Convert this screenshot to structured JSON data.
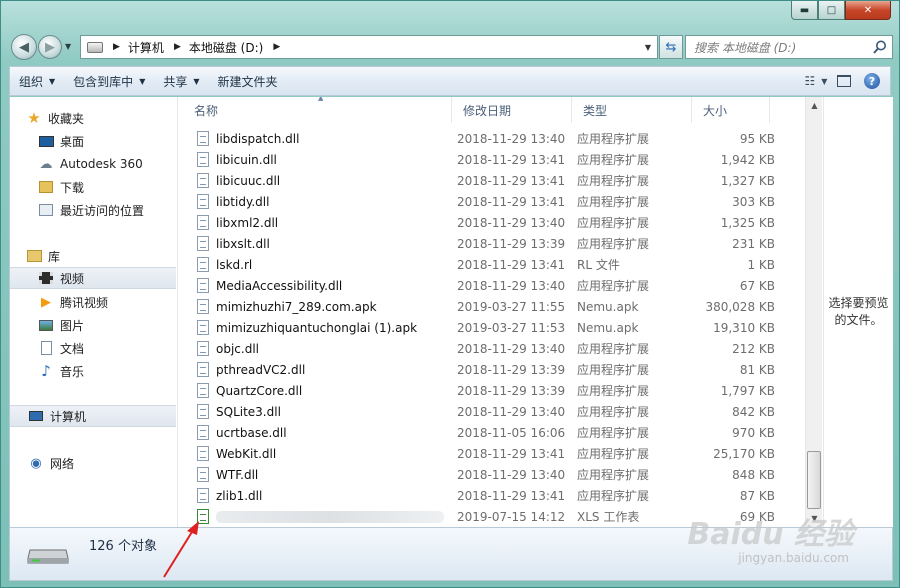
{
  "window": {
    "min_label": "▬",
    "max_label": "□",
    "close_label": "✕"
  },
  "address": {
    "segments": [
      "计算机",
      "本地磁盘 (D:)"
    ],
    "search_placeholder": "搜索 本地磁盘 (D:)"
  },
  "toolbar": {
    "organize": "组织",
    "include_in_library": "包含到库中",
    "share": "共享",
    "new_folder": "新建文件夹"
  },
  "sidebar": {
    "favorites": "收藏夹",
    "desktop": "桌面",
    "autodesk": "Autodesk 360",
    "downloads": "下载",
    "recent": "最近访问的位置",
    "libraries": "库",
    "videos": "视频",
    "tencent_video": "腾讯视频",
    "pictures": "图片",
    "documents": "文档",
    "music": "音乐",
    "computer": "计算机",
    "network": "网络"
  },
  "columns": {
    "name": "名称",
    "date": "修改日期",
    "type": "类型",
    "size": "大小"
  },
  "files": [
    {
      "name": "libdispatch.dll",
      "date": "2018-11-29 13:40",
      "type": "应用程序扩展",
      "size": "95 KB"
    },
    {
      "name": "libicuin.dll",
      "date": "2018-11-29 13:41",
      "type": "应用程序扩展",
      "size": "1,942 KB"
    },
    {
      "name": "libicuuc.dll",
      "date": "2018-11-29 13:41",
      "type": "应用程序扩展",
      "size": "1,327 KB"
    },
    {
      "name": "libtidy.dll",
      "date": "2018-11-29 13:41",
      "type": "应用程序扩展",
      "size": "303 KB"
    },
    {
      "name": "libxml2.dll",
      "date": "2018-11-29 13:40",
      "type": "应用程序扩展",
      "size": "1,325 KB"
    },
    {
      "name": "libxslt.dll",
      "date": "2018-11-29 13:39",
      "type": "应用程序扩展",
      "size": "231 KB"
    },
    {
      "name": "lskd.rl",
      "date": "2018-11-29 13:41",
      "type": "RL 文件",
      "size": "1 KB"
    },
    {
      "name": "MediaAccessibility.dll",
      "date": "2018-11-29 13:40",
      "type": "应用程序扩展",
      "size": "67 KB"
    },
    {
      "name": "mimizhuzhi7_289.com.apk",
      "date": "2019-03-27 11:55",
      "type": "Nemu.apk",
      "size": "380,028 KB"
    },
    {
      "name": "mimizuzhiquantuchonglai (1).apk",
      "date": "2019-03-27 11:53",
      "type": "Nemu.apk",
      "size": "19,310 KB"
    },
    {
      "name": "objc.dll",
      "date": "2018-11-29 13:40",
      "type": "应用程序扩展",
      "size": "212 KB"
    },
    {
      "name": "pthreadVC2.dll",
      "date": "2018-11-29 13:39",
      "type": "应用程序扩展",
      "size": "81 KB"
    },
    {
      "name": "QuartzCore.dll",
      "date": "2018-11-29 13:39",
      "type": "应用程序扩展",
      "size": "1,797 KB"
    },
    {
      "name": "SQLite3.dll",
      "date": "2018-11-29 13:40",
      "type": "应用程序扩展",
      "size": "842 KB"
    },
    {
      "name": "ucrtbase.dll",
      "date": "2018-11-05 16:06",
      "type": "应用程序扩展",
      "size": "970 KB"
    },
    {
      "name": "WebKit.dll",
      "date": "2018-11-29 13:41",
      "type": "应用程序扩展",
      "size": "25,170 KB"
    },
    {
      "name": "WTF.dll",
      "date": "2018-11-29 13:40",
      "type": "应用程序扩展",
      "size": "848 KB"
    },
    {
      "name": "zlib1.dll",
      "date": "2018-11-29 13:41",
      "type": "应用程序扩展",
      "size": "87 KB"
    },
    {
      "name": "",
      "date": "2019-07-15 14:12",
      "type": "XLS 工作表",
      "size": "69 KB"
    }
  ],
  "preview_text": "选择要预览的文件。",
  "status": {
    "object_count": "126 个对象"
  },
  "watermark": {
    "brand": "Baidu 经验",
    "site": "jingyan.baidu.com"
  }
}
